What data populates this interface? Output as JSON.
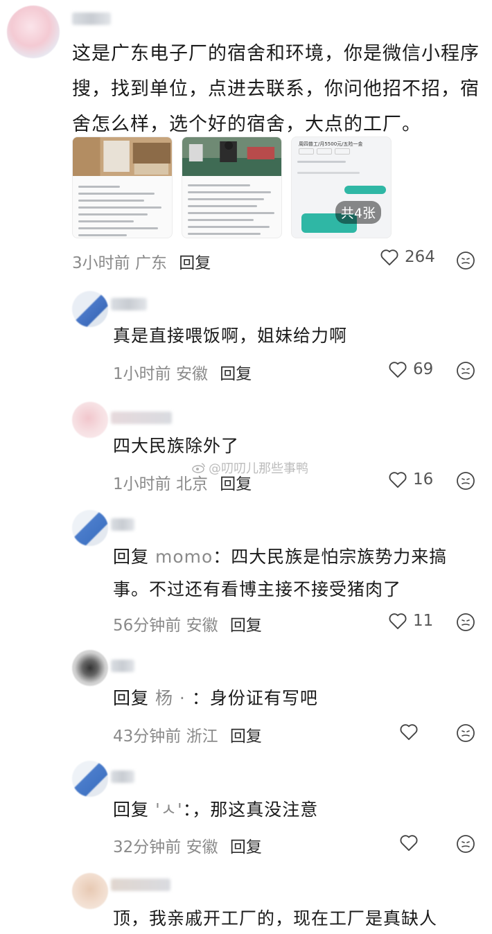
{
  "main_comment": {
    "text": "这是广东电子厂的宿舍和环境，你是微信小程序搜，找到单位，点进去联系，你问他招不招，宿舍怎么样，选个好的宿舍，大点的工厂。",
    "image_count_badge": "共4张",
    "thumb3_title": "周四普工/月5500元/五险一金",
    "time": "3小时前",
    "location": "广东",
    "reply_label": "回复",
    "likes": "264"
  },
  "replies": [
    {
      "text": "真是直接喂饭啊，姐妹给力啊",
      "time": "1小时前",
      "location": "安徽",
      "reply_label": "回复",
      "likes": "69"
    },
    {
      "text": "四大民族除外了",
      "time": "1小时前",
      "location": "北京",
      "reply_label": "回复",
      "likes": "16"
    },
    {
      "prefix": "回复",
      "to_user": "momo",
      "text": "：四大民族是怕宗族势力来搞事。不过还有看博主接不接受猪肉了",
      "time": "56分钟前",
      "location": "安徽",
      "reply_label": "回复",
      "likes": "11"
    },
    {
      "prefix": "回复",
      "to_user": "杨 · ",
      "text": "：身份证有写吧",
      "time": "43分钟前",
      "location": "浙江",
      "reply_label": "回复",
      "likes": ""
    },
    {
      "prefix": "回复",
      "to_user": "'ㅅ'",
      "text": "：，那这真没注意",
      "time": "32分钟前",
      "location": "安徽",
      "reply_label": "回复",
      "likes": ""
    },
    {
      "text": "顶，我亲戚开工厂的，现在工厂是真缺人"
    }
  ],
  "watermark": "@叨叨儿那些事鸭",
  "icons": {
    "like": "heart-icon",
    "emoji": "emoji-face-icon",
    "watermark": "weibo-logo-icon"
  },
  "colors": {
    "meta_gray": "#8a8a8a",
    "text": "#1a1a1a"
  }
}
